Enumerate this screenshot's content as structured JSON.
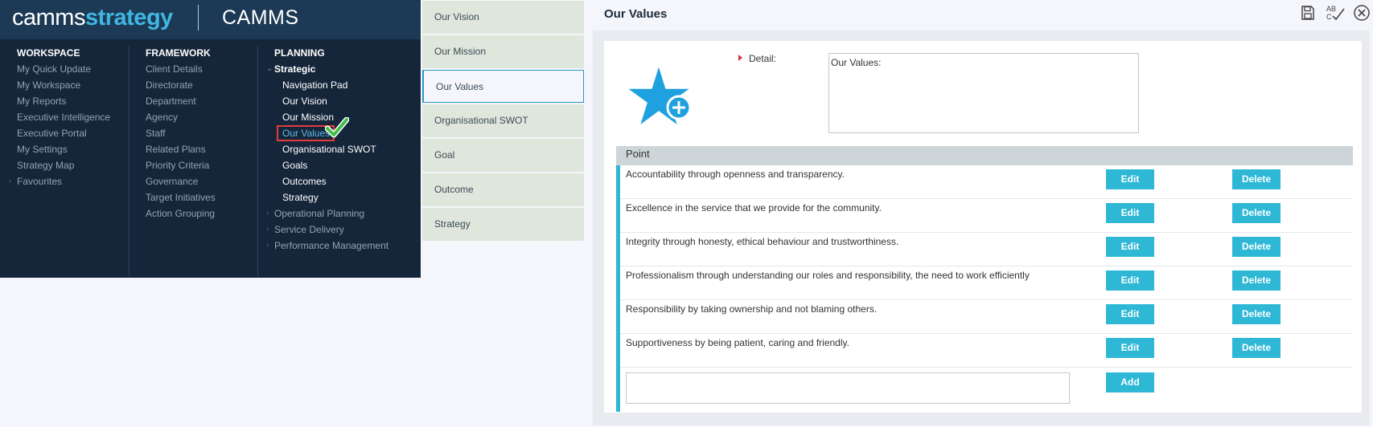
{
  "brand": {
    "logo_part1": "camms",
    "logo_part2": "strategy",
    "product": "CAMMS"
  },
  "menu": {
    "workspace": {
      "heading": "WORKSPACE",
      "items": [
        "My Quick Update",
        "My Workspace",
        "My Reports",
        "Executive Intelligence",
        "Executive Portal",
        "My Settings",
        "Strategy Map",
        "Favourites"
      ]
    },
    "framework": {
      "heading": "FRAMEWORK",
      "items": [
        "Client Details",
        "Directorate",
        "Department",
        "Agency",
        "Staff",
        "Related Plans",
        "Priority Criteria",
        "Governance",
        "Target Initiatives",
        "Action Grouping"
      ]
    },
    "planning": {
      "heading": "PLANNING",
      "strategic": "Strategic",
      "strategic_items": [
        "Navigation Pad",
        "Our Vision",
        "Our Mission",
        "Our Values",
        "Organisational SWOT",
        "Goals",
        "Outcomes",
        "Strategy"
      ],
      "other": [
        "Operational Planning",
        "Service Delivery",
        "Performance Management"
      ]
    }
  },
  "tabs": [
    "Our Vision",
    "Our Mission",
    "Our Values",
    "Organisational SWOT",
    "Goal",
    "Outcome",
    "Strategy"
  ],
  "page": {
    "title": "Our Values",
    "detail_label": "Detail:",
    "detail_value": "Our Values:",
    "points_header": "Point",
    "edit_label": "Edit",
    "delete_label": "Delete",
    "add_label": "Add",
    "points": [
      "Accountability through openness and transparency.",
      "Excellence in the service that we provide for the community.",
      "Integrity through honesty, ethical behaviour and trustworthiness.",
      "Professionalism through understanding our roles and responsibility, the need to work efficiently",
      "Responsibility by taking ownership and not blaming others.",
      "Supportiveness by being patient, caring and friendly."
    ]
  },
  "colors": {
    "accent": "#2eb8d6",
    "menu_bg": "#15263a",
    "selected_outline": "#e23c3c",
    "check": "#3fbf4a"
  },
  "icons": [
    "save-icon",
    "spellcheck-icon",
    "close-icon",
    "star-add-icon",
    "checkmark-icon"
  ]
}
